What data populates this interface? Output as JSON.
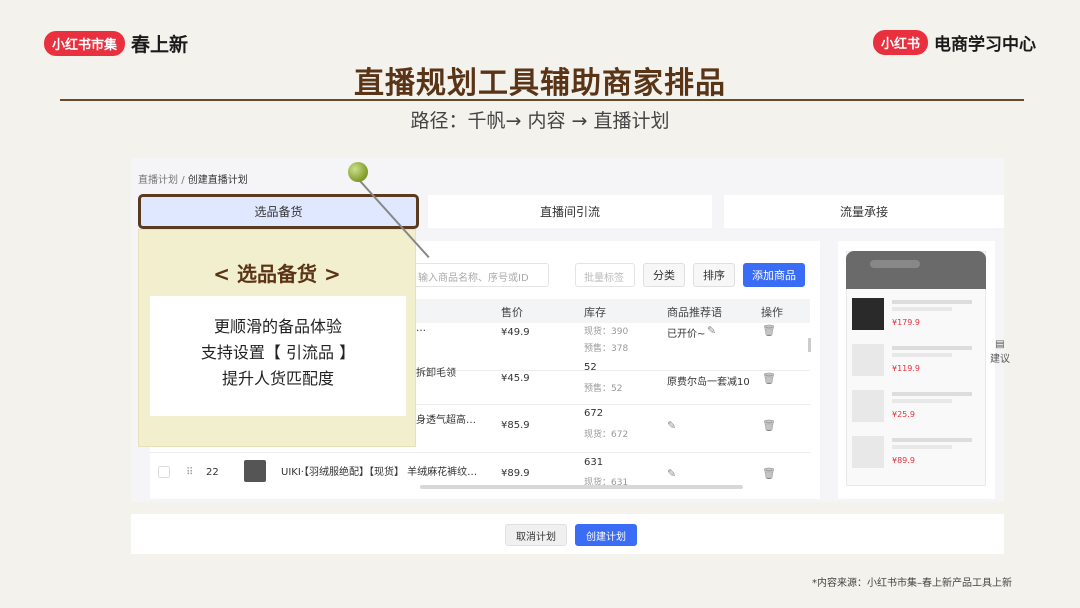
{
  "header": {
    "left_pill": "小红书市集",
    "left_text": "春上新",
    "right_pill": "小红书",
    "right_text": "电商学习中心"
  },
  "title": "直播规划工具辅助商家排品",
  "subtitle": "路径：千帆→ 内容 → 直播计划",
  "breadcrumb": {
    "parent": "直播计划",
    "sep": "/",
    "current": "创建直播计划"
  },
  "tabs": [
    "选品备货",
    "直播间引流",
    "流量承接"
  ],
  "toolbar": {
    "search_placeholder": "输入商品名称、序号或ID",
    "batch_label": "批量标签",
    "category": "分类",
    "sort": "排序",
    "add": "添加商品"
  },
  "table": {
    "headers": [
      "售价",
      "库存",
      "商品推荐语",
      "操作"
    ],
    "rows": [
      {
        "name": "…",
        "price": "¥49.9",
        "stock": "现货：390",
        "presale": "预售：378",
        "tag": "已开价~"
      },
      {
        "name": "拆卸毛领",
        "price": "¥45.9",
        "stock": "52",
        "presale": "预售：52",
        "tag": "原费尔岛一套减10"
      },
      {
        "name": "身透气超高…",
        "price": "¥85.9",
        "stock": "672",
        "presale": "现货：672",
        "tag": ""
      },
      {
        "num": "22",
        "name": "UIKI·【羽绒服绝配】【现货】 羊绒麻花裤纹…",
        "price": "¥89.9",
        "stock": "631",
        "presale": "现货：631",
        "tag": ""
      }
    ]
  },
  "callout": {
    "title": "< 选品备货 >",
    "lines": [
      "更顺滑的备品体验",
      "支持设置【 引流品 】",
      "提升人货匹配度"
    ]
  },
  "preview": {
    "prices": [
      "¥179.9",
      "¥119.9",
      "¥25.9",
      "¥89.9"
    ],
    "side_label": "建议"
  },
  "footer": {
    "cancel": "取消计划",
    "create": "创建计划",
    "source": "*内容来源：小红书市集–春上新产品工具上新"
  }
}
